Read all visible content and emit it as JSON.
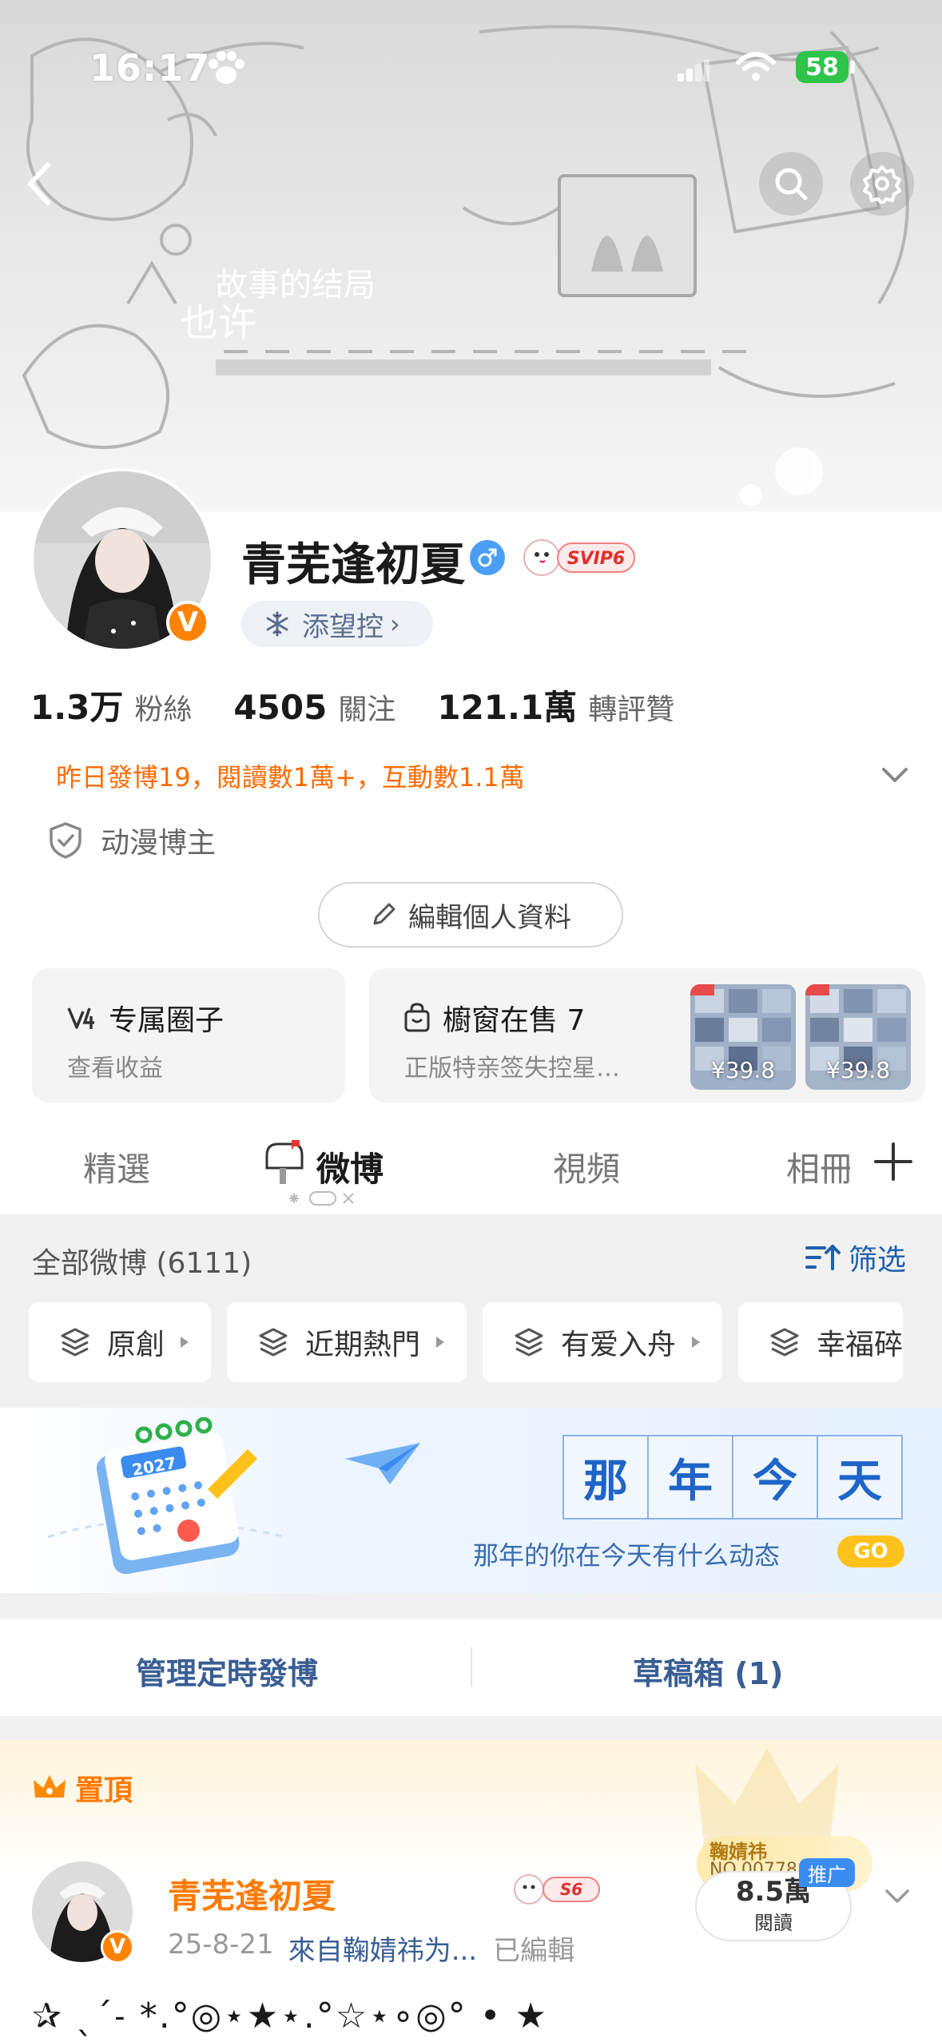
{
  "status_bar": {
    "time": "16:17",
    "battery": "58"
  },
  "banner": {
    "text_line1": "故事的结局",
    "text_line2": "也许"
  },
  "profile": {
    "username": "青芜逢初夏",
    "svip_label": "SVIP6",
    "fan_club_label": "添望控",
    "stats": [
      {
        "num": "1.3万",
        "label": "粉絲"
      },
      {
        "num": "4505",
        "label": "關注"
      },
      {
        "num": "121.1萬",
        "label": "轉評贊"
      }
    ],
    "yesterday": "昨日發博19，閱讀數1萬+，互動數1.1萬",
    "tag": "动漫博主",
    "edit_label": "編輯個人資料"
  },
  "cards": {
    "circle": {
      "title": "专属圈子",
      "sub": "查看收益"
    },
    "shop": {
      "title": "櫥窗在售 7",
      "sub": "正版特亲签失控星…",
      "prices": [
        "¥39.8",
        "¥39.8"
      ]
    }
  },
  "tabs": [
    {
      "label": "精選"
    },
    {
      "label": "微博"
    },
    {
      "label": "視頻"
    },
    {
      "label": "相冊"
    }
  ],
  "feed": {
    "header": "全部微博 (6111)",
    "filter_label": "筛选",
    "chips": [
      "原創",
      "近期熱門",
      "有爱入舟",
      "幸福碎"
    ],
    "memory": {
      "chars": [
        "那",
        "年",
        "今",
        "天"
      ],
      "sub": "那年的你在今天有什么动态",
      "go": "GO",
      "year": "2027"
    },
    "manage": {
      "scheduled": "管理定時發博",
      "drafts": "草稿箱 (1)"
    }
  },
  "pinned_post": {
    "pin_label": "置頂",
    "username": "青芜逢初夏",
    "badge": "S6",
    "date": "25-8-21",
    "source": "來自鞠婧祎为...",
    "edited": "已編輯",
    "reads_num": "8.5萬",
    "reads_label": "閱讀",
    "promo": "推广",
    "gold_tag": "鞠婧祎",
    "gold_no": "NO.00778",
    "text": "✰ ˎˊ˗ *.°◎⋆★⋆.°☆⋆∘◎° • ★"
  },
  "colors": {
    "orange": "#ff7a00",
    "link": "#3a5e94",
    "vip": "#ff8200",
    "accent_blue": "#1f64c8"
  }
}
